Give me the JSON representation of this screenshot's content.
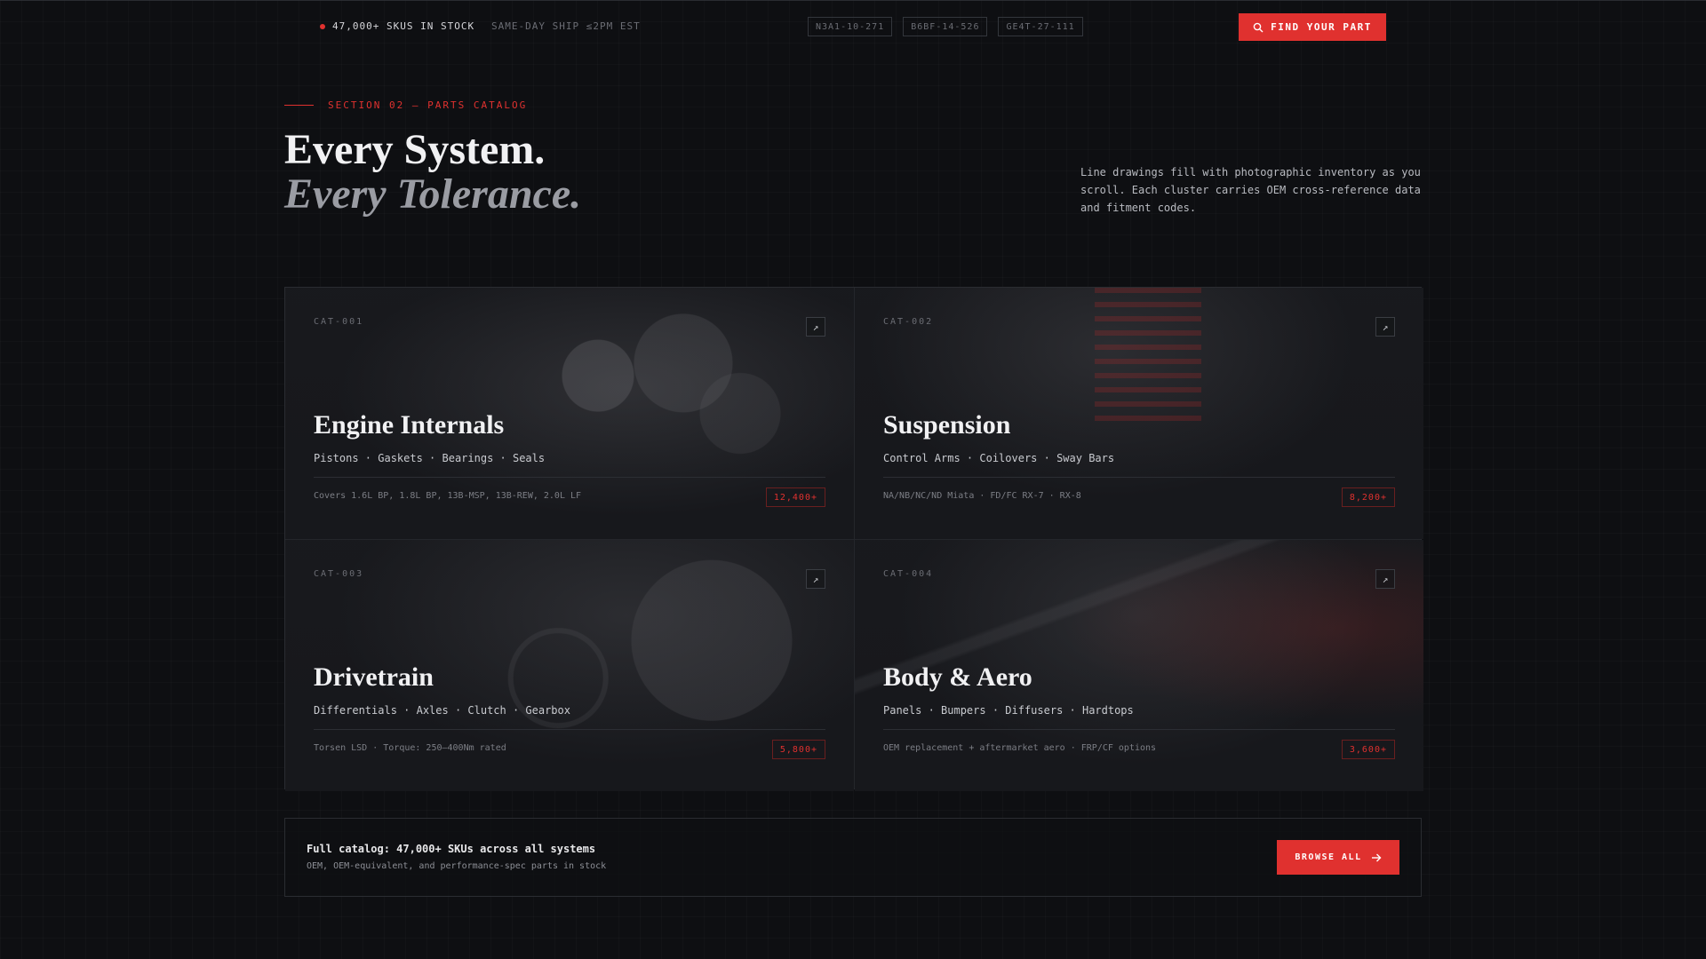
{
  "topbar": {
    "stock_text": "47,000+ SKUS IN STOCK",
    "ship_text": "SAME-DAY SHIP ≤2PM EST",
    "codes": [
      "N3A1-10-271",
      "B6BF-14-526",
      "GE4T-27-111"
    ],
    "find_button": "FIND YOUR PART"
  },
  "hero": {
    "section_label": "SECTION 02 — PARTS CATALOG",
    "title_line1": "Every System.",
    "title_line2": "Every Tolerance.",
    "description": "Line drawings fill with photographic inventory as you scroll. Each cluster carries OEM cross-reference data and fitment codes."
  },
  "categories": [
    {
      "id": "CAT-001",
      "title": "Engine Internals",
      "tags": "Pistons · Gaskets · Bearings · Seals",
      "meta": "Covers 1.6L BP, 1.8L BP, 13B-MSP, 13B-REW, 2.0L LF",
      "count": "12,400+"
    },
    {
      "id": "CAT-002",
      "title": "Suspension",
      "tags": "Control Arms · Coilovers · Sway Bars",
      "meta": "NA/NB/NC/ND Miata · FD/FC RX-7 · RX-8",
      "count": "8,200+"
    },
    {
      "id": "CAT-003",
      "title": "Drivetrain",
      "tags": "Differentials · Axles · Clutch · Gearbox",
      "meta": "Torsen LSD · Torque: 250–400Nm rated",
      "count": "5,800+"
    },
    {
      "id": "CAT-004",
      "title": "Body & Aero",
      "tags": "Panels · Bumpers · Diffusers · Hardtops",
      "meta": "OEM replacement + aftermarket aero · FRP/CF options",
      "count": "3,600+"
    }
  ],
  "footer": {
    "title": "Full catalog: 47,000+ SKUs across all systems",
    "subtitle": "OEM, OEM-equivalent, and performance-spec parts in stock",
    "browse_button": "BROWSE ALL"
  },
  "colors": {
    "accent": "#e0312f",
    "background": "#0e0f12",
    "card": "#17181c"
  },
  "icons": {
    "stock_indicator": "red-dot",
    "find_button": "search-icon",
    "card_link": "arrow-up-right-icon",
    "browse_button": "arrow-right-icon"
  }
}
